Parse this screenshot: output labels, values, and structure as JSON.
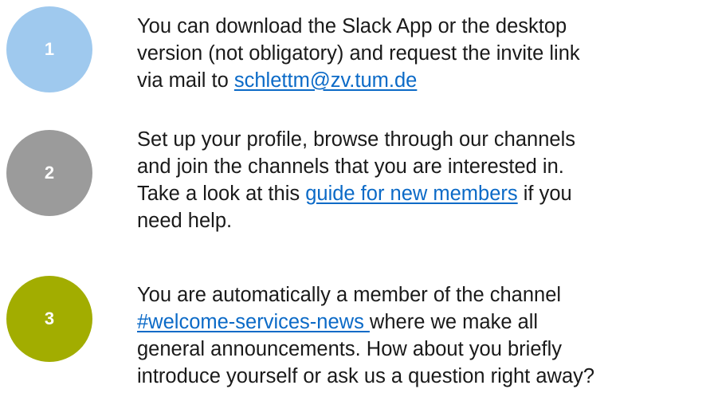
{
  "steps": [
    {
      "number": "1",
      "color": "#9fc9ee",
      "lines": {
        "l1": "You can download the Slack App or the desktop",
        "l2": "version (not obligatory) and request the invite link",
        "l3_pre": "via mail to ",
        "l3_link": "schlettm@zv.tum.de"
      }
    },
    {
      "number": "2",
      "color": "#9b9b9b",
      "lines": {
        "l1": "Set up your profile, browse through our channels",
        "l2": "and join the channels that you are interested in.",
        "l3_pre": "Take a look at this ",
        "l3_link": "guide for new members",
        "l3_post": " if you",
        "l4": "need help."
      }
    },
    {
      "number": "3",
      "color": "#a2ad00",
      "lines": {
        "l1": "You are automatically a member of the channel",
        "l2_link": "#welcome-services-news ",
        "l2_post": "where we make all",
        "l3": "general announcements. How about you briefly",
        "l4": "introduce yourself or ask us a question right away?"
      }
    }
  ]
}
